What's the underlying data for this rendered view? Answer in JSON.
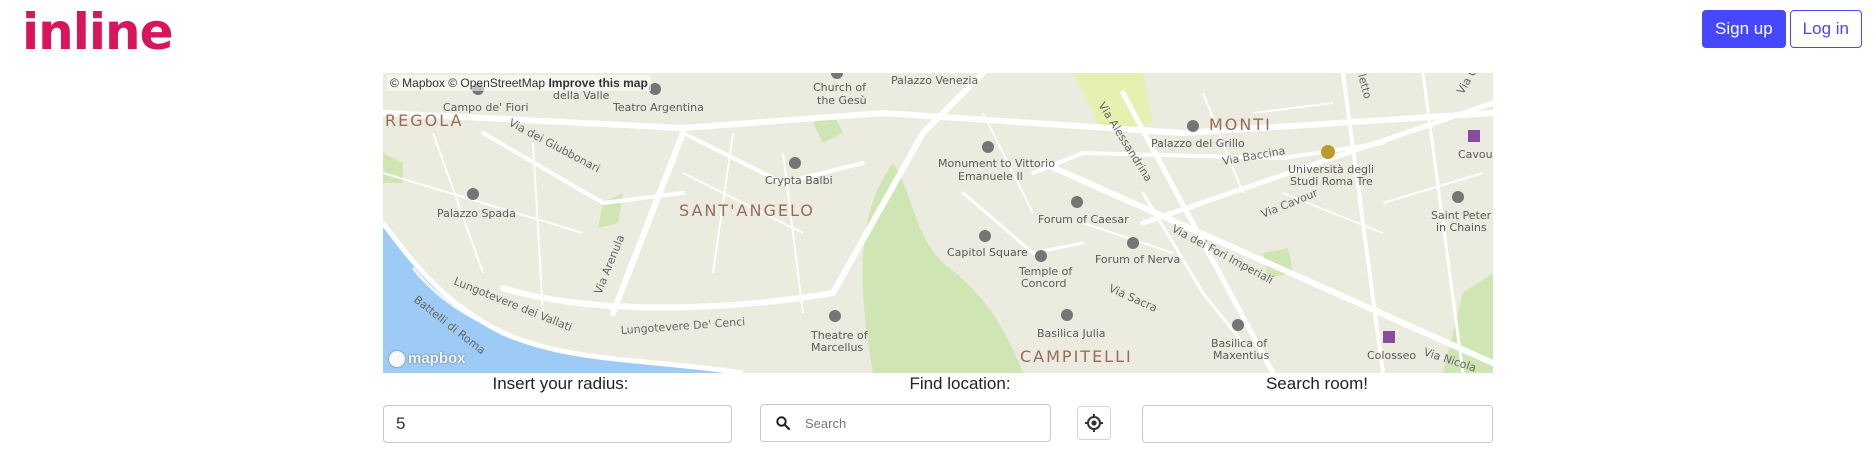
{
  "brand": {
    "logo_text": "inline",
    "color": "#d8145c"
  },
  "header": {
    "signup_label": "Sign up",
    "login_label": "Log in",
    "accent": "#4648ff"
  },
  "map": {
    "attribution": {
      "mapbox": "© Mapbox",
      "osm": "© OpenStreetMap",
      "improve": "Improve this map"
    },
    "logo_text": "mapbox",
    "districts": [
      "REGOLA",
      "SANT'ANGELO",
      "MONTI",
      "CAMPITELLI"
    ],
    "places": {
      "campo_de_fiori": "Campo de' Fiori",
      "della_valle": "della Valle",
      "teatro_argentina": "Teatro Argentina",
      "church_of": "Church of",
      "the_gesu": "the Gesù",
      "palazzo_venezia": "Palazzo Venezia",
      "palazzo_spada": "Palazzo Spada",
      "crypta_balbi": "Crypta Balbi",
      "monument_1": "Monument to Vittorio",
      "monument_2": "Emanuele II",
      "palazzo_del_grillo": "Palazzo del Grillo",
      "univ_1": "Università degli",
      "univ_2": "Studi Roma Tre",
      "cavour": "Cavour",
      "saint_peter_1": "Saint Peter",
      "saint_peter_2": "in Chains",
      "forum_caesar": "Forum of Caesar",
      "forum_nerva": "Forum of Nerva",
      "capitol_square": "Capitol Square",
      "temple_1": "Temple of",
      "temple_2": "Concord",
      "basilica_julia": "Basilica Julia",
      "basilica_max_1": "Basilica of",
      "basilica_max_2": "Maxentius",
      "colosseo": "Colosseo",
      "theatre_1": "Theatre of",
      "theatre_2": "Marcellus"
    },
    "streets": {
      "via_giubbonari": "Via dei Giubbonari",
      "via_arenula": "Via Arenula",
      "lung_vallati": "Lungotevere dei Vallati",
      "lung_cenci": "Lungotevere De' Cenci",
      "battelli": "Battelli di Roma",
      "via_alessandrina": "Via Alessandrina",
      "via_baccina": "Via Baccina",
      "via_cavour": "Via Cavour",
      "via_fori": "Via dei Fori Imperiali",
      "via_sacra": "Via Sacra",
      "via_nicola": "Via Nicola",
      "via_urb": "Via Urb",
      "letto": "letto",
      "lungotevere": "Lungotevere"
    }
  },
  "controls": {
    "radius_label": "Insert your radius:",
    "radius_value": "5",
    "location_label": "Find location:",
    "location_placeholder": "Search",
    "room_label": "Search room!",
    "room_value": ""
  }
}
